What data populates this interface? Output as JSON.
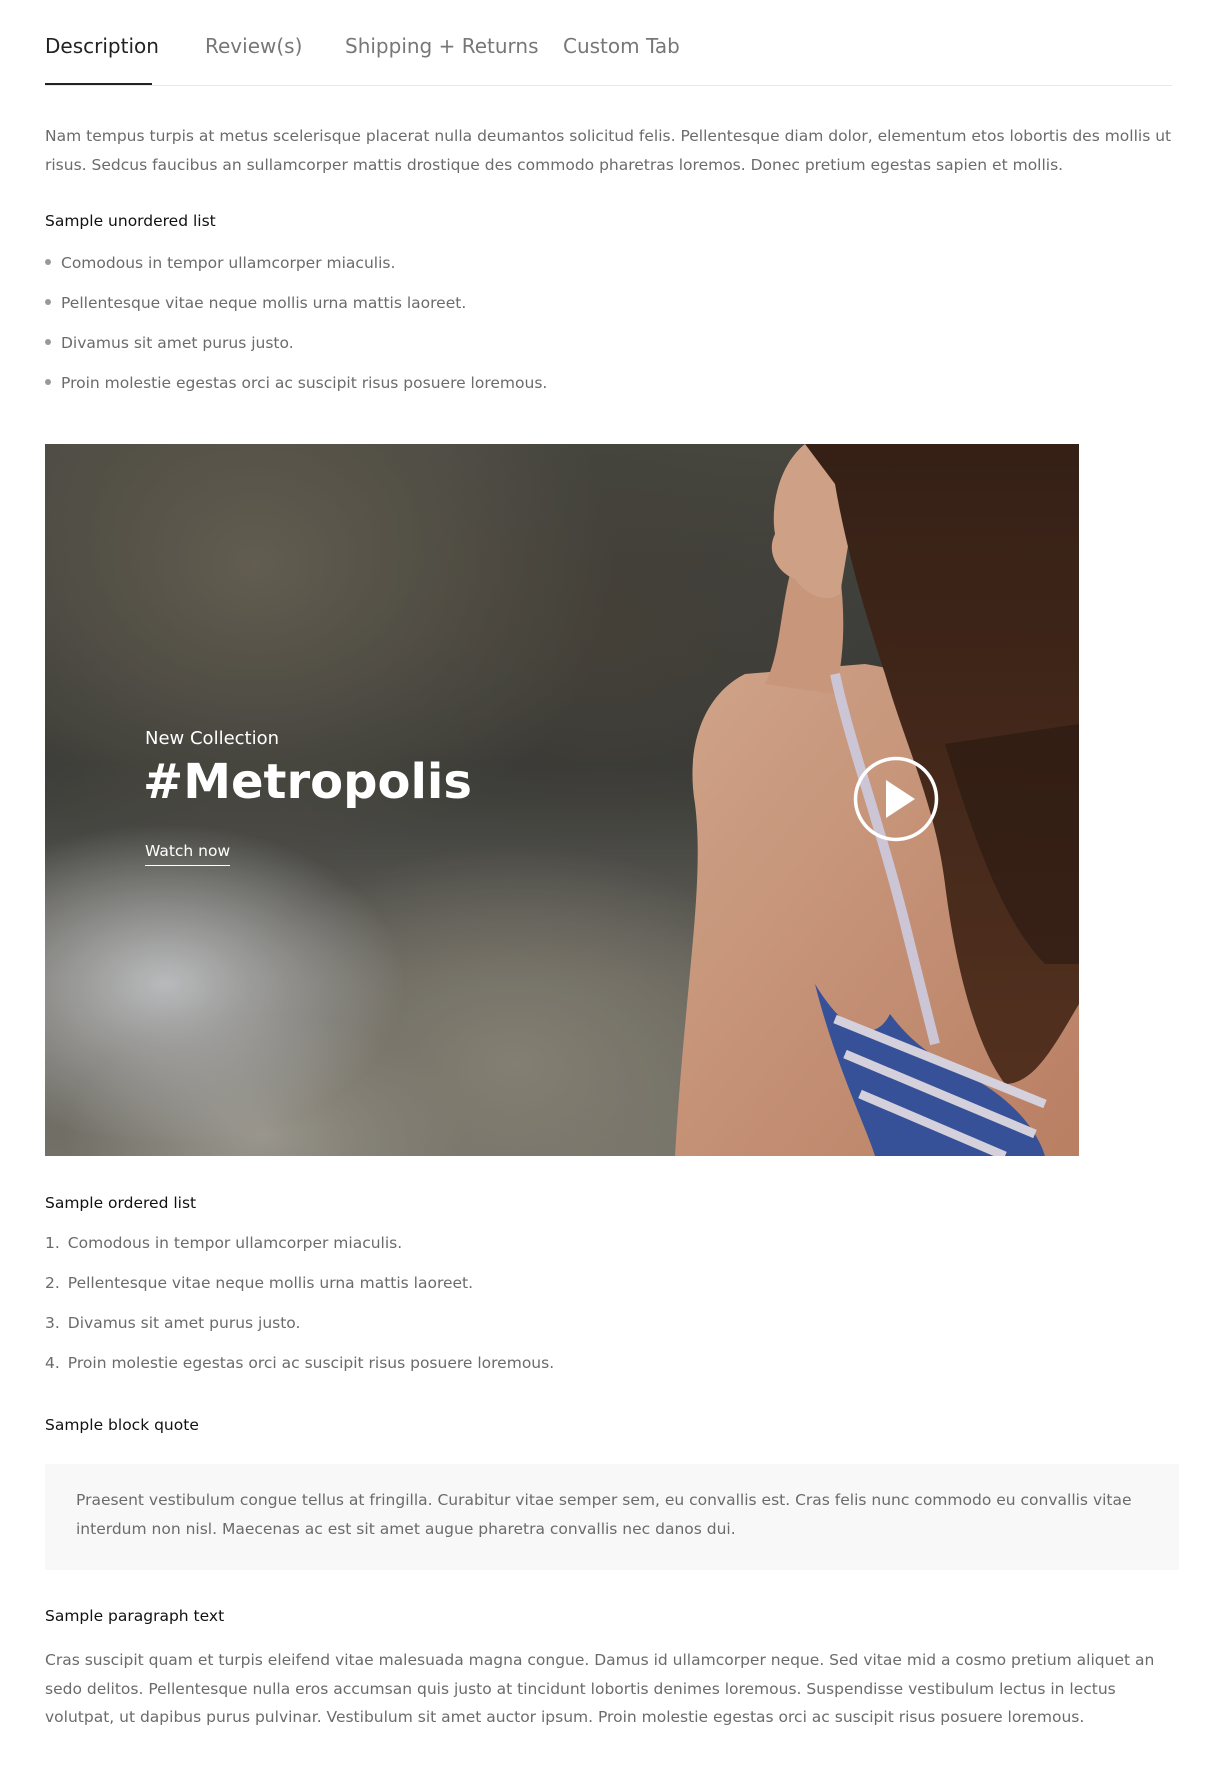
{
  "tabs": {
    "description": "Description",
    "reviews": "Review(s)",
    "shipping": "Shipping + Returns",
    "custom": "Custom Tab"
  },
  "intro": "Nam tempus turpis at metus scelerisque placerat nulla deumantos solicitud felis. Pellentesque diam dolor, elementum etos lobortis des mollis ut risus. Sedcus faucibus an sullamcorper mattis drostique des commodo pharetras loremos. Donec pretium egestas sapien et mollis.",
  "unordered": {
    "heading": "Sample unordered list",
    "items": [
      "Comodous in tempor ullamcorper miaculis.",
      "Pellentesque vitae neque mollis urna mattis laoreet.",
      "Divamus sit amet purus justo.",
      "Proin molestie egestas orci ac suscipit risus posuere loremous."
    ]
  },
  "video": {
    "subtitle": "New Collection",
    "title": "#Metropolis",
    "link": "Watch now",
    "icon": "play-icon"
  },
  "ordered": {
    "heading": "Sample ordered list",
    "numbers": [
      "1.",
      "2.",
      "3.",
      "4."
    ],
    "items": [
      "Comodous in tempor ullamcorper miaculis.",
      "Pellentesque vitae neque mollis urna mattis laoreet.",
      "Divamus sit amet purus justo.",
      "Proin molestie egestas orci ac suscipit risus posuere loremous."
    ]
  },
  "blockquote": {
    "heading": "Sample block quote",
    "text": "Praesent vestibulum congue tellus at fringilla. Curabitur vitae semper sem, eu convallis est. Cras felis nunc commodo eu convallis vitae interdum non nisl. Maecenas ac est sit amet augue pharetra convallis nec danos dui."
  },
  "paragraph": {
    "heading": "Sample paragraph text",
    "text": "Cras suscipit quam et turpis eleifend vitae malesuada magna congue. Damus id ullamcorper neque. Sed vitae mid a cosmo pretium aliquet an sedo delitos. Pellentesque nulla eros accumsan quis justo at tincidunt lobortis denimes loremous. Suspendisse vestibulum lectus in lectus volutpat, ut dapibus purus pulvinar. Vestibulum sit amet auctor ipsum. Proin molestie egestas orci ac suscipit risus posuere loremous."
  },
  "colors": {
    "text": "#6b6b6b",
    "heading": "#111111",
    "tab_active": "#222222",
    "tab_inactive": "#777777",
    "quote_bg": "#f8f8f8"
  }
}
